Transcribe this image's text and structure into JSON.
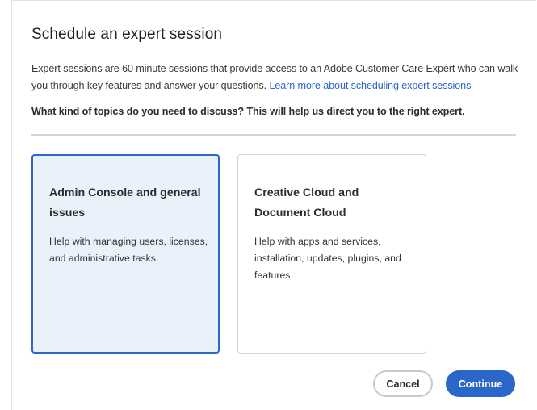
{
  "dialog": {
    "title": "Schedule an expert session",
    "description": "Expert sessions are 60 minute sessions that provide access to an Adobe Customer Care Expert who can walk you through key features and answer your questions. ",
    "learn_more_link": "Learn more about scheduling expert sessions",
    "question": "What kind of topics do you need to discuss? This will help us direct you to the right expert."
  },
  "options": [
    {
      "title": "Admin Console and general issues",
      "description": "Help with managing users, licenses, and administrative tasks",
      "selected": true
    },
    {
      "title": "Creative Cloud and Document Cloud",
      "description": "Help with apps and services, installation, updates, plugins, and features",
      "selected": false
    }
  ],
  "buttons": {
    "cancel_label": "Cancel",
    "continue_label": "Continue"
  },
  "colors": {
    "accent": "#2a67c9",
    "selected_card_background": "#e9f1fb",
    "link": "#2a66c9"
  }
}
